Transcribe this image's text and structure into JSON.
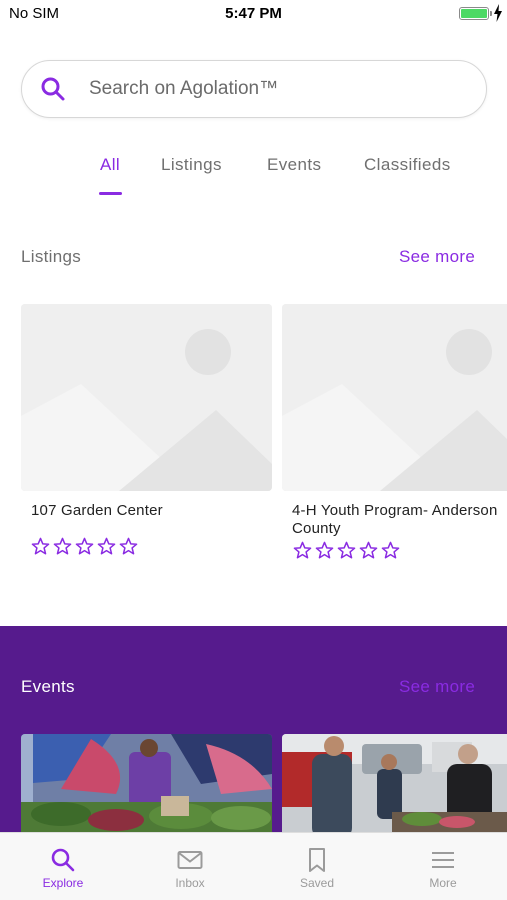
{
  "status_bar": {
    "carrier": "No SIM",
    "time": "5:47 PM",
    "battery_level": 1.0
  },
  "search": {
    "placeholder": "Search on Agolation™",
    "value": ""
  },
  "tabs": [
    {
      "label": "All",
      "active": true
    },
    {
      "label": "Listings",
      "active": false
    },
    {
      "label": "Events",
      "active": false
    },
    {
      "label": "Classifieds",
      "active": false
    }
  ],
  "listings": {
    "title": "Listings",
    "see_more_label": "See more",
    "items": [
      {
        "title": "107 Garden Center",
        "rating": 0,
        "max_rating": 5
      },
      {
        "title_line1": "4-H Youth Program- Anderson",
        "title_line2": "County",
        "rating": 0,
        "max_rating": 5
      }
    ]
  },
  "events": {
    "title": "Events",
    "see_more_label": "See more",
    "items": [
      {
        "photo_icon": "market-produce-photo"
      },
      {
        "photo_icon": "market-vendors-photo"
      }
    ]
  },
  "bottom_nav": [
    {
      "label": "Explore",
      "icon": "search-icon",
      "active": true
    },
    {
      "label": "Inbox",
      "icon": "mail-icon",
      "active": false
    },
    {
      "label": "Saved",
      "icon": "bookmark-icon",
      "active": false
    },
    {
      "label": "More",
      "icon": "menu-icon",
      "active": false
    }
  ],
  "colors": {
    "accent": "#8a2be2",
    "events_background": "#561b8d",
    "placeholder_image": "#efefef"
  }
}
